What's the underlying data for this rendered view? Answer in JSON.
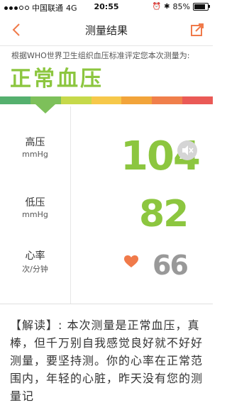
{
  "status_bar": {
    "carrier": "中国联通",
    "network": "4G",
    "time": "20:55",
    "battery": "85%",
    "battery_level": 0.85
  },
  "nav": {
    "title": "测量结果"
  },
  "notice": "根据WHO世界卫生组织血压标准评定您本次测量为:",
  "result": "正常血压",
  "level_colors": [
    "#55b06e",
    "#7dc05a",
    "#c6d94a",
    "#f6c84a",
    "#f2a43a",
    "#f07f4b",
    "#ea5a56"
  ],
  "colors": {
    "accent": "#8cc63f",
    "heart": "#f07a4a",
    "back_arrow": "#f07a4a"
  },
  "measurements": {
    "systolic": {
      "label": "高压",
      "unit": "mmHg",
      "value": "104"
    },
    "diastolic": {
      "label": "低压",
      "unit": "mmHg",
      "value": "82"
    },
    "heart_rate": {
      "label": "心率",
      "unit": "次/分钟",
      "value": "66"
    }
  },
  "icons": {
    "back": "back-arrow-icon",
    "share": "share-icon",
    "mute": "speaker-mute-icon",
    "heart": "heart-icon"
  },
  "interpretation": "【解读】: 本次测量是正常血压，真棒，但千万别自我感觉良好就不好好测量，要坚持测。你的心率在正常范围内，年轻的心脏，昨天没有您的测量记"
}
